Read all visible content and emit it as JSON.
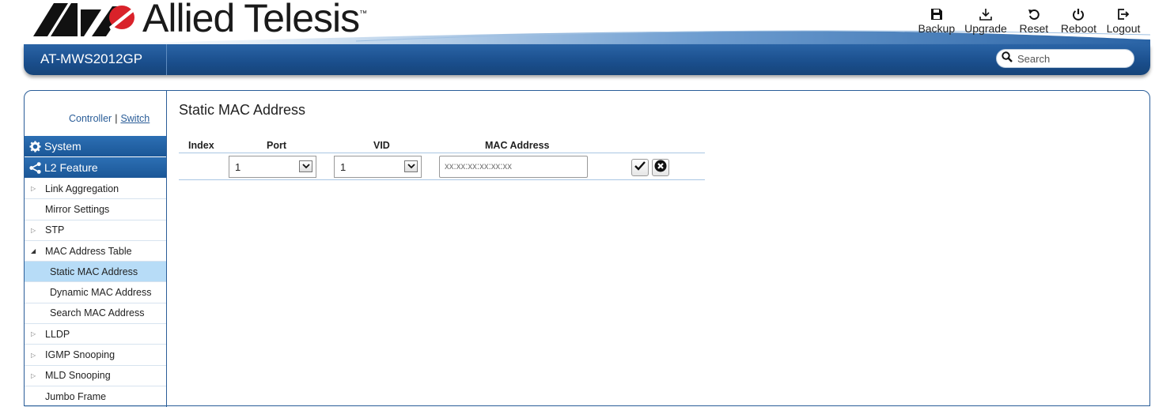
{
  "brand": {
    "name": "Allied Telesis",
    "tm": "™"
  },
  "top_actions": [
    {
      "label": "Backup",
      "icon": "save-icon"
    },
    {
      "label": "Upgrade",
      "icon": "download-icon"
    },
    {
      "label": "Reset",
      "icon": "reset-icon"
    },
    {
      "label": "Reboot",
      "icon": "power-icon"
    },
    {
      "label": "Logout",
      "icon": "logout-icon"
    }
  ],
  "navbar": {
    "model": "AT-MWS2012GP",
    "search_placeholder": "Search"
  },
  "mode_switch": {
    "controller": "Controller",
    "separator": "|",
    "switch": "Switch",
    "active": "Switch"
  },
  "sidebar": {
    "sections": [
      {
        "label": "System",
        "icon": "gear-icon"
      },
      {
        "label": "L2 Feature",
        "icon": "share-icon"
      }
    ],
    "items": [
      {
        "label": "Link Aggregation",
        "marker": "▷"
      },
      {
        "label": "Mirror Settings",
        "marker": ""
      },
      {
        "label": "STP",
        "marker": "▷"
      },
      {
        "label": "MAC Address Table",
        "marker": "◢"
      },
      {
        "label": "Static MAC Address",
        "marker": "",
        "sub": true,
        "selected": true
      },
      {
        "label": "Dynamic MAC Address",
        "marker": "",
        "sub": true
      },
      {
        "label": "Search MAC Address",
        "marker": "",
        "sub": true
      },
      {
        "label": "LLDP",
        "marker": "▷"
      },
      {
        "label": "IGMP Snooping",
        "marker": "▷"
      },
      {
        "label": "MLD Snooping",
        "marker": "▷"
      },
      {
        "label": "Jumbo Frame",
        "marker": ""
      }
    ]
  },
  "main": {
    "title": "Static MAC Address",
    "table": {
      "headers": {
        "index": "Index",
        "port": "Port",
        "vid": "VID",
        "mac": "MAC Address"
      },
      "row": {
        "port": "1",
        "vid": "1",
        "mac_placeholder": "xx:xx:xx:xx:xx:xx"
      }
    }
  },
  "colors": {
    "accent": "#1b5797",
    "selected": "#b7dcf7",
    "border": "#2a5d98"
  }
}
